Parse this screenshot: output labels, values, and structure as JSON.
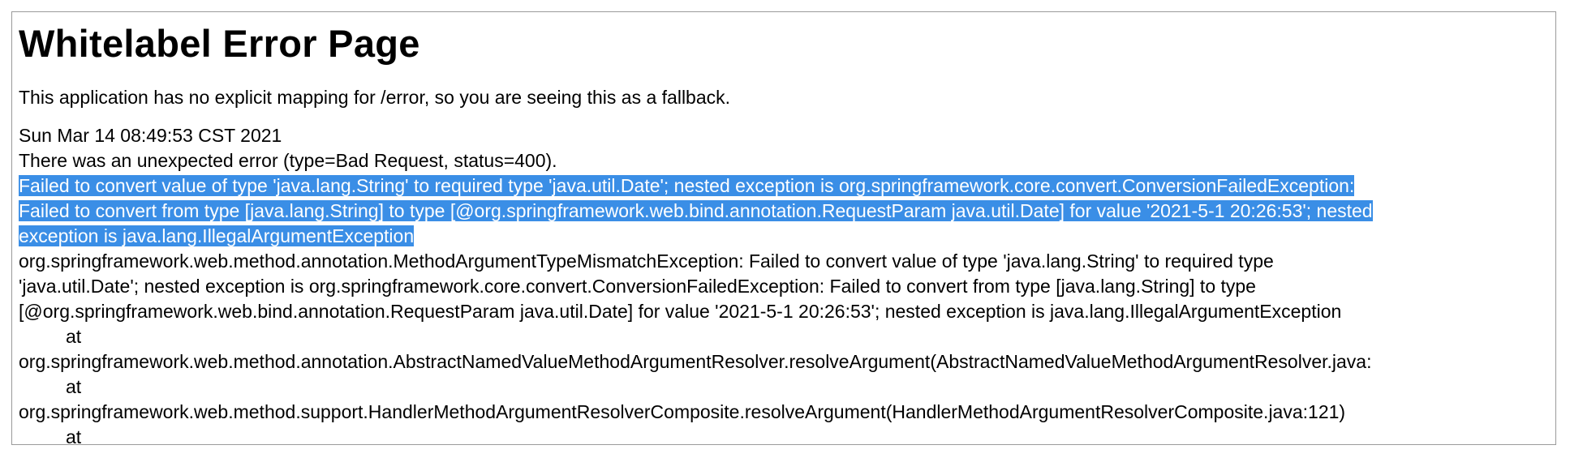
{
  "page": {
    "title": "Whitelabel Error Page",
    "fallback_message": "This application has no explicit mapping for /error, so you are seeing this as a fallback."
  },
  "error": {
    "timestamp": "Sun Mar 14 08:49:53 CST 2021",
    "summary": "There was an unexpected error (type=Bad Request, status=400).",
    "message_lines": [
      "Failed to convert value of type 'java.lang.String' to required type 'java.util.Date'; nested exception is org.springframework.core.convert.ConversionFailedException:",
      "Failed to convert from type [java.lang.String] to type [@org.springframework.web.bind.annotation.RequestParam java.util.Date] for value '2021-5-1 20:26:53'; nested",
      "exception is java.lang.IllegalArgumentException"
    ],
    "trace_lines": [
      "org.springframework.web.method.annotation.MethodArgumentTypeMismatchException: Failed to convert value of type 'java.lang.String' to required type",
      "'java.util.Date'; nested exception is org.springframework.core.convert.ConversionFailedException: Failed to convert from type [java.lang.String] to type",
      "[@org.springframework.web.bind.annotation.RequestParam java.util.Date] for value '2021-5-1 20:26:53'; nested exception is java.lang.IllegalArgumentException",
      "at",
      "org.springframework.web.method.annotation.AbstractNamedValueMethodArgumentResolver.resolveArgument(AbstractNamedValueMethodArgumentResolver.java:",
      "at",
      "org.springframework.web.method.support.HandlerMethodArgumentResolverComposite.resolveArgument(HandlerMethodArgumentResolverComposite.java:121)",
      "at"
    ]
  },
  "colors": {
    "selection_background": "#3a8ee6",
    "selection_text": "#ffffff",
    "frame_border": "#9a9a9a"
  }
}
